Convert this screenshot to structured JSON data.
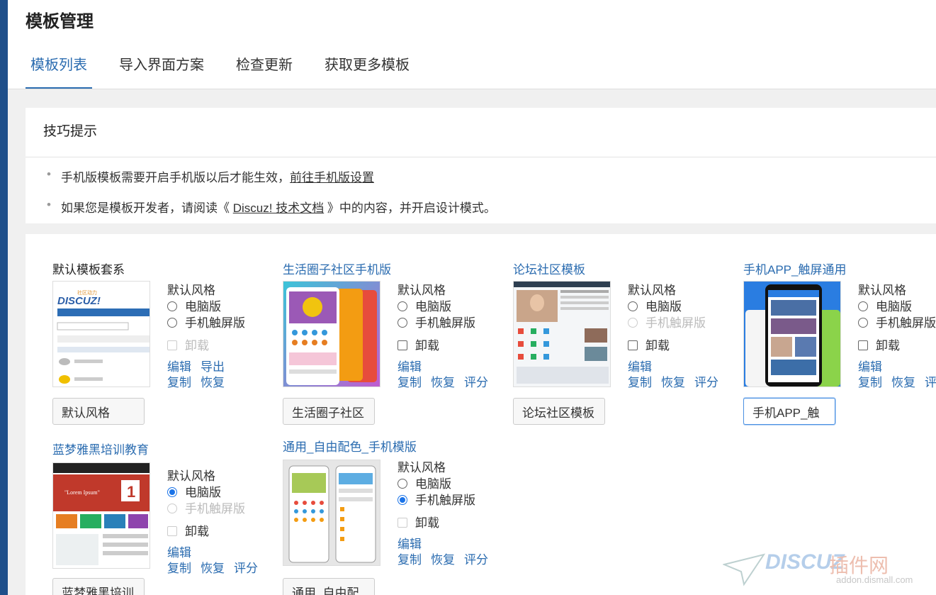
{
  "page": {
    "title": "模板管理"
  },
  "tabs": [
    {
      "label": "模板列表",
      "active": true
    },
    {
      "label": "导入界面方案",
      "active": false
    },
    {
      "label": "检查更新",
      "active": false
    },
    {
      "label": "获取更多模板",
      "active": false
    }
  ],
  "tips": {
    "title": "技巧提示",
    "line1_text": "手机版模板需要开启手机版以后才能生效，",
    "line1_link": "前往手机版设置",
    "line2_prefix": "如果您是模板开发者，请阅读《 ",
    "line2_link": "Discuz! 技术文档",
    "line2_suffix": " 》中的内容，并开启设计模式。"
  },
  "labels": {
    "default_style": "默认风格",
    "pc": "电脑版",
    "mobile": "手机触屏版",
    "uninstall": "卸载",
    "edit": "编辑",
    "export": "导出",
    "copy": "复制",
    "restore": "恢复",
    "rate": "评分"
  },
  "templates": [
    {
      "name": "默认模板套系",
      "input_value": "默认风格",
      "pc_checked": false,
      "mobile_checked": false,
      "mobile_disabled": false
    },
    {
      "name": "生活圈子社区手机版",
      "input_value": "生活圈子社区",
      "pc_checked": false,
      "mobile_checked": false,
      "mobile_disabled": false
    },
    {
      "name": "论坛社区模板",
      "input_value": "论坛社区模板",
      "pc_checked": false,
      "mobile_checked": false,
      "mobile_disabled": true
    },
    {
      "name": "手机APP_触屏通用",
      "input_value": "手机APP_触",
      "pc_checked": false,
      "mobile_checked": false,
      "mobile_disabled": false
    },
    {
      "name": "蓝梦雅黑培训教育",
      "input_value": "蓝梦雅黑培训",
      "pc_checked": true,
      "mobile_checked": false,
      "mobile_disabled": true
    },
    {
      "name": "通用_自由配色_手机模版",
      "input_value": "通用_自由配",
      "pc_checked": false,
      "mobile_checked": true,
      "mobile_disabled": false
    }
  ],
  "watermark": {
    "brand": "DISCUZ",
    "cn": "插件网",
    "url": "addon.dismall.com"
  },
  "colors": {
    "accent": "#2b6cb0",
    "sidebar": "#1f4f8a",
    "radio_checked": "#1a73e8"
  }
}
